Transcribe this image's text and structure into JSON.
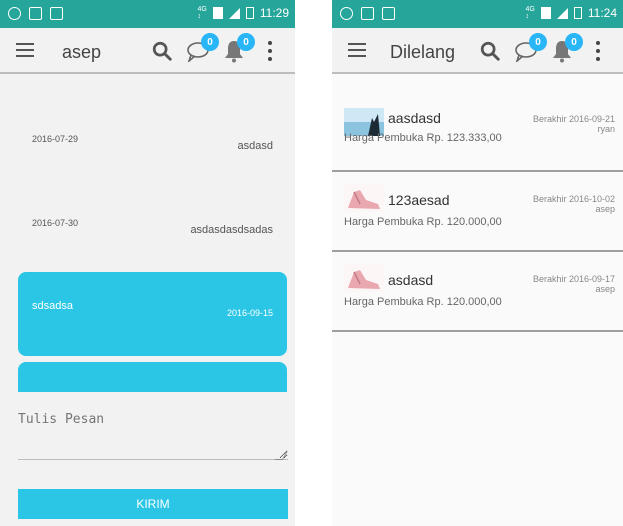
{
  "left_screen": {
    "status_time": "11:29",
    "title": "asep",
    "chat_badge": "0",
    "notif_badge": "0",
    "messages": [
      {
        "date": "2016-07-29",
        "text": "asdasd",
        "mine": false
      },
      {
        "date": "2016-07-30",
        "text": "asdasdasdsadas",
        "mine": false
      },
      {
        "date": "2016-09-15",
        "text": "sdsadsa",
        "mine": true
      }
    ],
    "compose_placeholder": "Tulis Pesan",
    "send_label": "KIRIM"
  },
  "right_screen": {
    "status_time": "11:24",
    "title": "Dilelang",
    "chat_badge": "0",
    "notif_badge": "0",
    "items": [
      {
        "name": "aasdasd",
        "price": "Harga Pembuka Rp. 123.333,00",
        "end": "Berakhir 2016-09-21",
        "user": "ryan",
        "thumb": "sky"
      },
      {
        "name": "123aesad",
        "price": "Harga Pembuka Rp. 120.000,00",
        "end": "Berakhir 2016-10-02",
        "user": "asep",
        "thumb": "shoe"
      },
      {
        "name": "asdasd",
        "price": "Harga Pembuka Rp. 120.000,00",
        "end": "Berakhir 2016-09-17",
        "user": "asep",
        "thumb": "shoe"
      }
    ]
  },
  "colors": {
    "statusbar": "#26a69a",
    "accent": "#2bc6e6",
    "badge": "#29b6f6"
  },
  "icons": [
    "menu-icon",
    "search-icon",
    "chat-icon",
    "bell-icon",
    "more-vert-icon"
  ]
}
